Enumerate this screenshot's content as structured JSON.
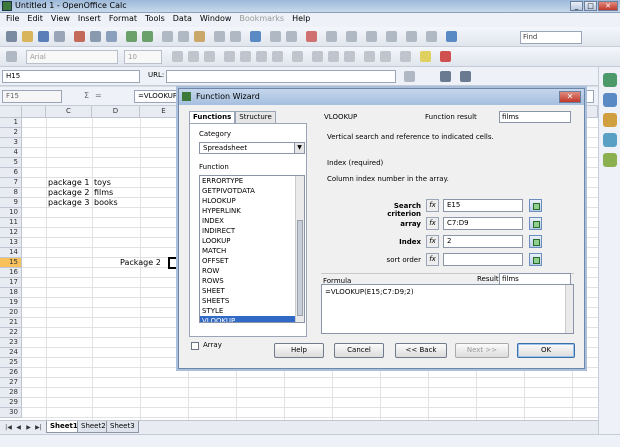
{
  "window": {
    "title": "Untitled 1 - OpenOffice Calc",
    "controls": [
      "_",
      "□",
      "✕"
    ]
  },
  "menu": [
    "File",
    "Edit",
    "View",
    "Insert",
    "Format",
    "Tools",
    "Data",
    "Window",
    "Bookmarks",
    "Help"
  ],
  "toolbar": {
    "find_placeholder": "Find",
    "font_name": "Arial",
    "font_size": "10"
  },
  "namebox": {
    "value": "H15",
    "url_label": "URL:"
  },
  "formula_bar": {
    "cell_ref": "F15",
    "content": "=VLOOKUP("
  },
  "sheet": {
    "columns": [
      "C",
      "D",
      "E"
    ],
    "rows": [
      "1",
      "2",
      "3",
      "4",
      "5",
      "6",
      "7",
      "8",
      "9",
      "10",
      "11",
      "12",
      "13",
      "14",
      "15",
      "16",
      "17",
      "18",
      "19",
      "20",
      "21",
      "22",
      "23",
      "24",
      "25",
      "26",
      "27",
      "28",
      "29",
      "30"
    ],
    "cells": {
      "c7": "package 1",
      "d7": "toys",
      "c8": "package 2",
      "d8": "films",
      "c9": "package 3",
      "d9": "books",
      "e15": "Package 2"
    },
    "tabs": [
      "Sheet1",
      "Sheet2",
      "Sheet3"
    ],
    "active_tab": "Sheet1"
  },
  "dialog": {
    "title": "Function Wizard",
    "tabs": [
      "Functions",
      "Structure"
    ],
    "category_label": "Category",
    "category_value": "Spreadsheet",
    "function_label": "Function",
    "functions": [
      "ERRORTYPE",
      "GETPIVOTDATA",
      "HLOOKUP",
      "HYPERLINK",
      "INDEX",
      "INDIRECT",
      "LOOKUP",
      "MATCH",
      "OFFSET",
      "ROW",
      "ROWS",
      "SHEET",
      "SHEETS",
      "STYLE",
      "VLOOKUP"
    ],
    "selected_function": "VLOOKUP",
    "array_checkbox_label": "Array",
    "function_name": "VLOOKUP",
    "function_result_label": "Function result",
    "function_result_value": "films",
    "description": "Vertical search and reference to indicated cells.",
    "arg_title": "Index (required)",
    "arg_description": "Column index number in the array.",
    "args": [
      {
        "label": "Search criterion",
        "value": "E15",
        "bold": true
      },
      {
        "label": "array",
        "value": "C7:D9",
        "bold": true
      },
      {
        "label": "Index",
        "value": "2",
        "bold": true
      },
      {
        "label": "sort order",
        "value": "",
        "bold": false
      }
    ],
    "formula_label": "Formula",
    "result_label": "Result",
    "result_value": "films",
    "formula_value": "=VLOOKUP(E15;C7:D9;2)",
    "buttons": {
      "help": "Help",
      "cancel": "Cancel",
      "back": "<< Back",
      "next": "Next >>",
      "ok": "OK"
    }
  }
}
